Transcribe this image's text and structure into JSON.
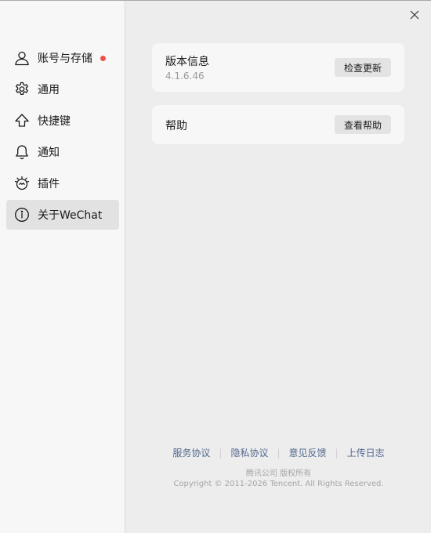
{
  "sidebar": {
    "items": [
      {
        "label": "账号与存储",
        "icon": "user-icon",
        "badge": true
      },
      {
        "label": "通用",
        "icon": "gear-icon"
      },
      {
        "label": "快捷键",
        "icon": "arrow-up-icon"
      },
      {
        "label": "通知",
        "icon": "bell-icon"
      },
      {
        "label": "插件",
        "icon": "plugin-icon"
      },
      {
        "label": "关于WeChat",
        "icon": "info-icon",
        "active": true
      }
    ]
  },
  "version_card": {
    "title": "版本信息",
    "version": "4.1.6.46",
    "button": "检查更新"
  },
  "help_card": {
    "title": "帮助",
    "button": "查看帮助"
  },
  "footer": {
    "links": [
      "服务协议",
      "隐私协议",
      "意见反馈",
      "上传日志"
    ],
    "company": "腾讯公司 版权所有",
    "copyright": "Copyright © 2011-2026 Tencent. All Rights Reserved."
  },
  "colors": {
    "badge": "#f25149",
    "link": "#53698f",
    "active_bg": "#e2e2e2"
  }
}
